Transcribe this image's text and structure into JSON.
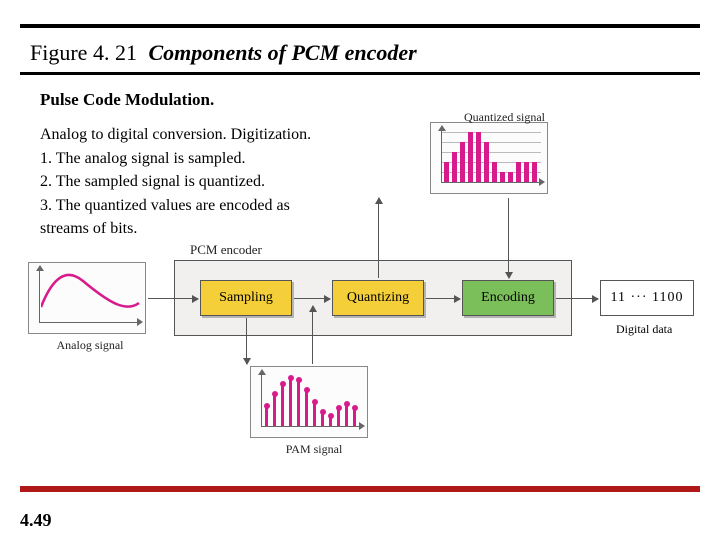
{
  "figure_number": "Figure 4. 21",
  "figure_title": "Components of PCM encoder",
  "subtitle": "Pulse Code Modulation.",
  "description": {
    "intro": "Analog to digital conversion. Digitization.",
    "step1": "1. The analog signal is sampled.",
    "step2": "2. The sampled signal is quantized.",
    "step3": "3. The quantized values are encoded as",
    "step3b": "streams of bits."
  },
  "page_number": "4.49",
  "labels": {
    "analog_signal": "Analog signal",
    "pcm_encoder": "PCM encoder",
    "sampling": "Sampling",
    "quantizing": "Quantizing",
    "encoding": "Encoding",
    "pam_signal": "PAM signal",
    "quantized_signal": "Quantized signal",
    "digital_data": "Digital data",
    "output_bits": "11 ··· 1100"
  },
  "chart_data": {
    "type": "diagram",
    "pam_sample_heights": [
      20,
      32,
      42,
      48,
      46,
      36,
      24,
      14,
      10,
      18,
      22,
      18
    ],
    "quantized_heights": [
      20,
      30,
      40,
      50,
      50,
      40,
      20,
      10,
      10,
      20,
      20,
      20
    ],
    "note": "pixel-height approximations of lollipop stems in illustration"
  }
}
